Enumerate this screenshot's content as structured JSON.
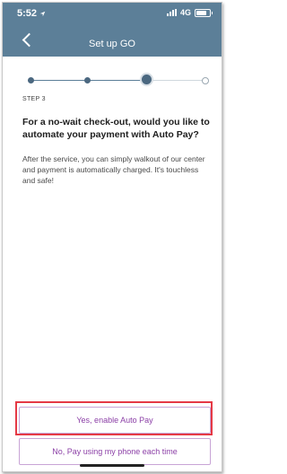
{
  "status_bar": {
    "time": "5:52",
    "location_icon": "location-arrow-icon",
    "network": "4G"
  },
  "nav": {
    "title": "Set up GO",
    "back_icon": "chevron-left-icon"
  },
  "stepper": {
    "total_steps": 4,
    "current_step": 3
  },
  "content": {
    "step_label": "STEP 3",
    "question": "For a no-wait check-out, would you like to automate your payment with Auto Pay?",
    "description": "After the service, you can simply walkout of our center and payment is automatically charged. It's touchless and safe!"
  },
  "buttons": {
    "enable_label": "Yes, enable Auto Pay",
    "decline_label": "No, Pay using my phone each time"
  },
  "colors": {
    "header": "#5c7f98",
    "accent_text": "#8b3fa6",
    "highlight": "#e53945"
  }
}
